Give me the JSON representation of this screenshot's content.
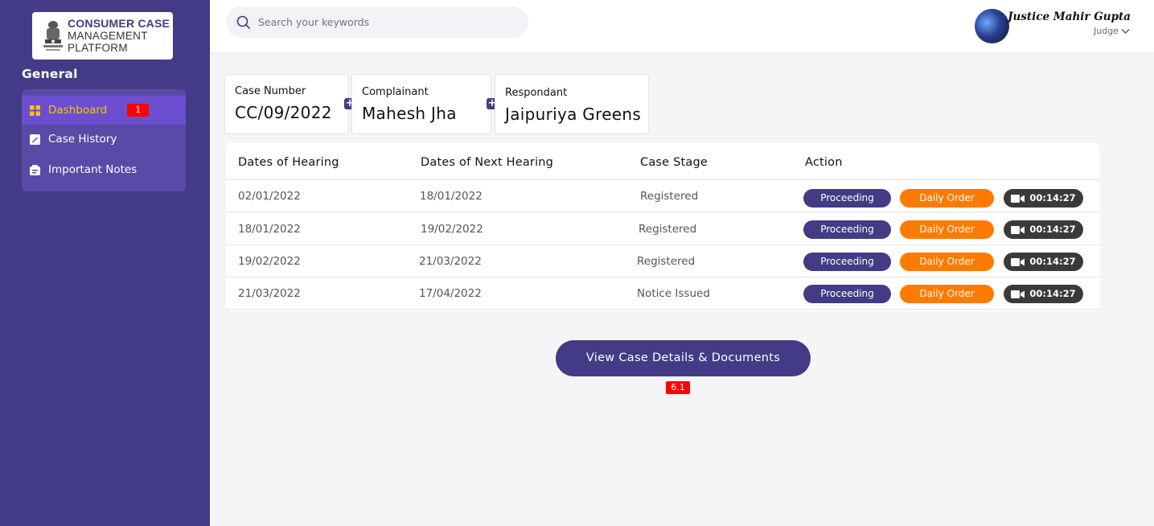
{
  "brand": {
    "line1": "CONSUMER CASE",
    "line2": "MANAGEMENT",
    "line3": "PLATFORM",
    "accent": "#433b85"
  },
  "sidebar": {
    "section_title": "General",
    "items": [
      {
        "label": "Dashboard",
        "icon": "grid-icon",
        "active": true,
        "badge": "1"
      },
      {
        "label": "Case History",
        "icon": "edit-note-icon",
        "active": false
      },
      {
        "label": "Important Notes",
        "icon": "notes-icon",
        "active": false
      }
    ]
  },
  "header": {
    "search_placeholder": "Search your keywords",
    "user_name": "Justice Mahir Gupta",
    "user_role": "Judge"
  },
  "case_info": {
    "case_number_label": "Case Number",
    "case_number": "CC/09/2022",
    "complainant_label": "Complainant",
    "complainant": "Mahesh Jha",
    "respondant_label": "Respondant",
    "respondant": "Jaipuriya Greens"
  },
  "table": {
    "columns": [
      "Dates of Hearing",
      "Dates of Next Hearing",
      "Case Stage",
      "Action"
    ],
    "rows": [
      {
        "hearing": "02/01/2022",
        "next": "18/01/2022",
        "stage": "Registered"
      },
      {
        "hearing": "18/01/2022",
        "next": "19/02/2022",
        "stage": "Registered"
      },
      {
        "hearing": "19/02/2022",
        "next": "21/03/2022",
        "stage": "Registered"
      },
      {
        "hearing": "21/03/2022",
        "next": "17/04/2022",
        "stage": "Notice Issued"
      }
    ],
    "action_proceeding": "Proceeding",
    "action_daily": "Daily Order",
    "action_video": "00:14:27",
    "colors": {
      "proceeding": "#433b85",
      "daily": "#ff7a00",
      "video": "#3a3a3a"
    }
  },
  "footer": {
    "view_button": "View Case Details & Documents",
    "version_badge": "6.1"
  }
}
